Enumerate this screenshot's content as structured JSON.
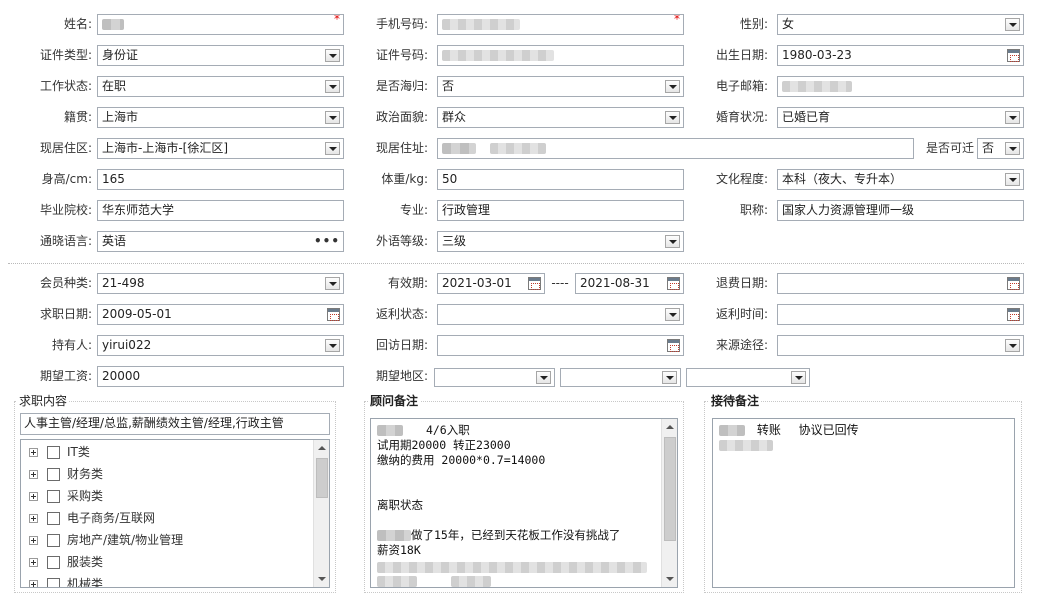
{
  "row1": {
    "name_label": "姓名:",
    "phone_label": "手机号码:",
    "gender_label": "性别:",
    "gender_value": "女",
    "required_mark": "*"
  },
  "row2": {
    "idtype_label": "证件类型:",
    "idtype_value": "身份证",
    "idno_label": "证件号码:",
    "birth_label": "出生日期:",
    "birth_value": "1980-03-23"
  },
  "row3": {
    "workstatus_label": "工作状态:",
    "workstatus_value": "在职",
    "returnee_label": "是否海归:",
    "returnee_value": "否",
    "email_label": "电子邮箱:"
  },
  "row4": {
    "native_label": "籍贯:",
    "native_value": "上海市",
    "political_label": "政治面貌:",
    "political_value": "群众",
    "marital_label": "婚育状况:",
    "marital_value": "已婚已育"
  },
  "row5": {
    "residence_label": "现居住区:",
    "residence_value": "上海市-上海市-[徐汇区]",
    "address_label": "现居住址:",
    "relocate_label": "是否可迁",
    "relocate_value": "否"
  },
  "row6": {
    "height_label": "身高/cm:",
    "height_value": "165",
    "weight_label": "体重/kg:",
    "weight_value": "50",
    "education_label": "文化程度:",
    "education_value": "本科（夜大、专升本）"
  },
  "row7": {
    "school_label": "毕业院校:",
    "school_value": "华东师范大学",
    "major_label": "专业:",
    "major_value": "行政管理",
    "title_label": "职称:",
    "title_value": "国家人力资源管理师一级"
  },
  "row8": {
    "language_label": "通晓语言:",
    "language_value": "英语",
    "language_more": "•••",
    "level_label": "外语等级:",
    "level_value": "三级"
  },
  "member": {
    "type_label": "会员种类:",
    "type_value": "21-498",
    "valid_label": "有效期:",
    "valid_from": "2021-03-01",
    "valid_sep": "----",
    "valid_to": "2021-08-31",
    "refund_label": "退费日期:"
  },
  "job": {
    "jobdate_label": "求职日期:",
    "jobdate_value": "2009-05-01",
    "rebate_status_label": "返利状态:",
    "rebate_time_label": "返利时间:",
    "holder_label": "持有人:",
    "holder_value": "yirui022",
    "visit_label": "回访日期:",
    "source_label": "来源途径:",
    "salary_label": "期望工资:",
    "salary_value": "20000",
    "region_label": "期望地区:"
  },
  "job_content": {
    "title": "求职内容",
    "summary": "人事主管/经理/总监,薪酬绩效主管/经理,行政主管",
    "categories": [
      "IT类",
      "财务类",
      "采购类",
      "电子商务/互联网",
      "房地产/建筑/物业管理",
      "服装类",
      "机械类"
    ]
  },
  "advisor_notes": {
    "title": "顾问备注",
    "lines": [
      "4/6入职",
      "试用期20000  转正23000",
      "缴纳的费用 20000*0.7=14000",
      "",
      "",
      "离职状态",
      "",
      "做了15年，已经到天花板工作没有挑战了",
      "薪资18K"
    ]
  },
  "reception_notes": {
    "title": "接待备注",
    "line1_a": "转账",
    "line1_b": "协议已回传"
  },
  "colors": {
    "border": "#a5acb5",
    "required": "#e00000",
    "panel_border": "#9aa3ad"
  }
}
